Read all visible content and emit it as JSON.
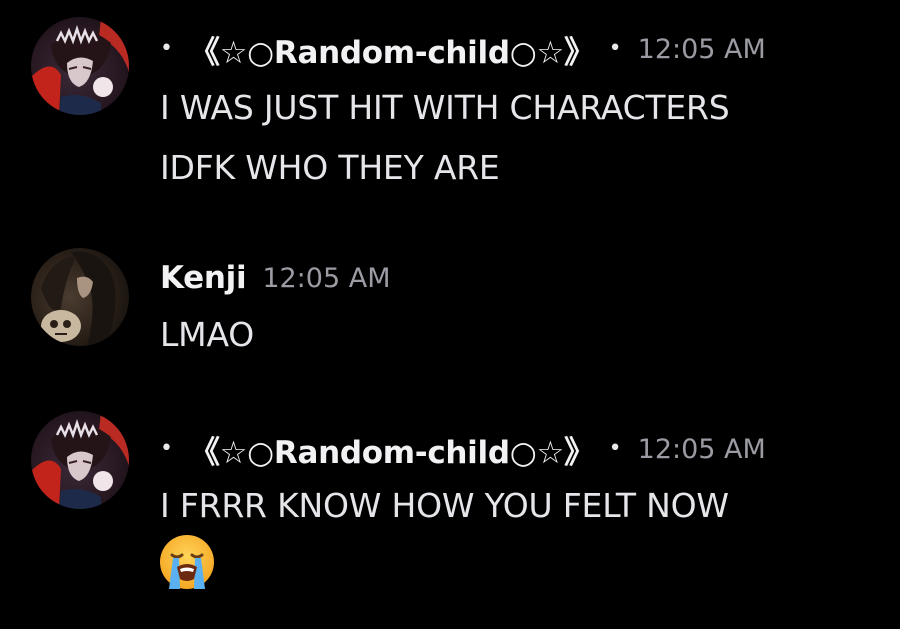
{
  "messages": [
    {
      "author": "《☆○Random-child○☆》",
      "bullet": "•",
      "time": "12:05 AM",
      "avatar_icon": "anime-character-avatar-icon",
      "lines": [
        "I WAS JUST HIT WITH CHARACTERS",
        "IDFK WHO THEY ARE"
      ]
    },
    {
      "author": "Kenji",
      "time": "12:05 AM",
      "avatar_icon": "skull-character-avatar-icon",
      "lines": [
        "LMAO"
      ]
    },
    {
      "author": "《☆○Random-child○☆》",
      "bullet": "•",
      "time": "12:05 AM",
      "avatar_icon": "anime-character-avatar-icon",
      "lines": [
        "I FRRR KNOW HOW YOU FELT NOW"
      ],
      "emoji": "loudly-crying-face-emoji"
    }
  ],
  "colors": {
    "background": "#000000",
    "username": "#f2f2f4",
    "timestamp": "#9a9ba3",
    "message_text": "#e6e6ea"
  }
}
